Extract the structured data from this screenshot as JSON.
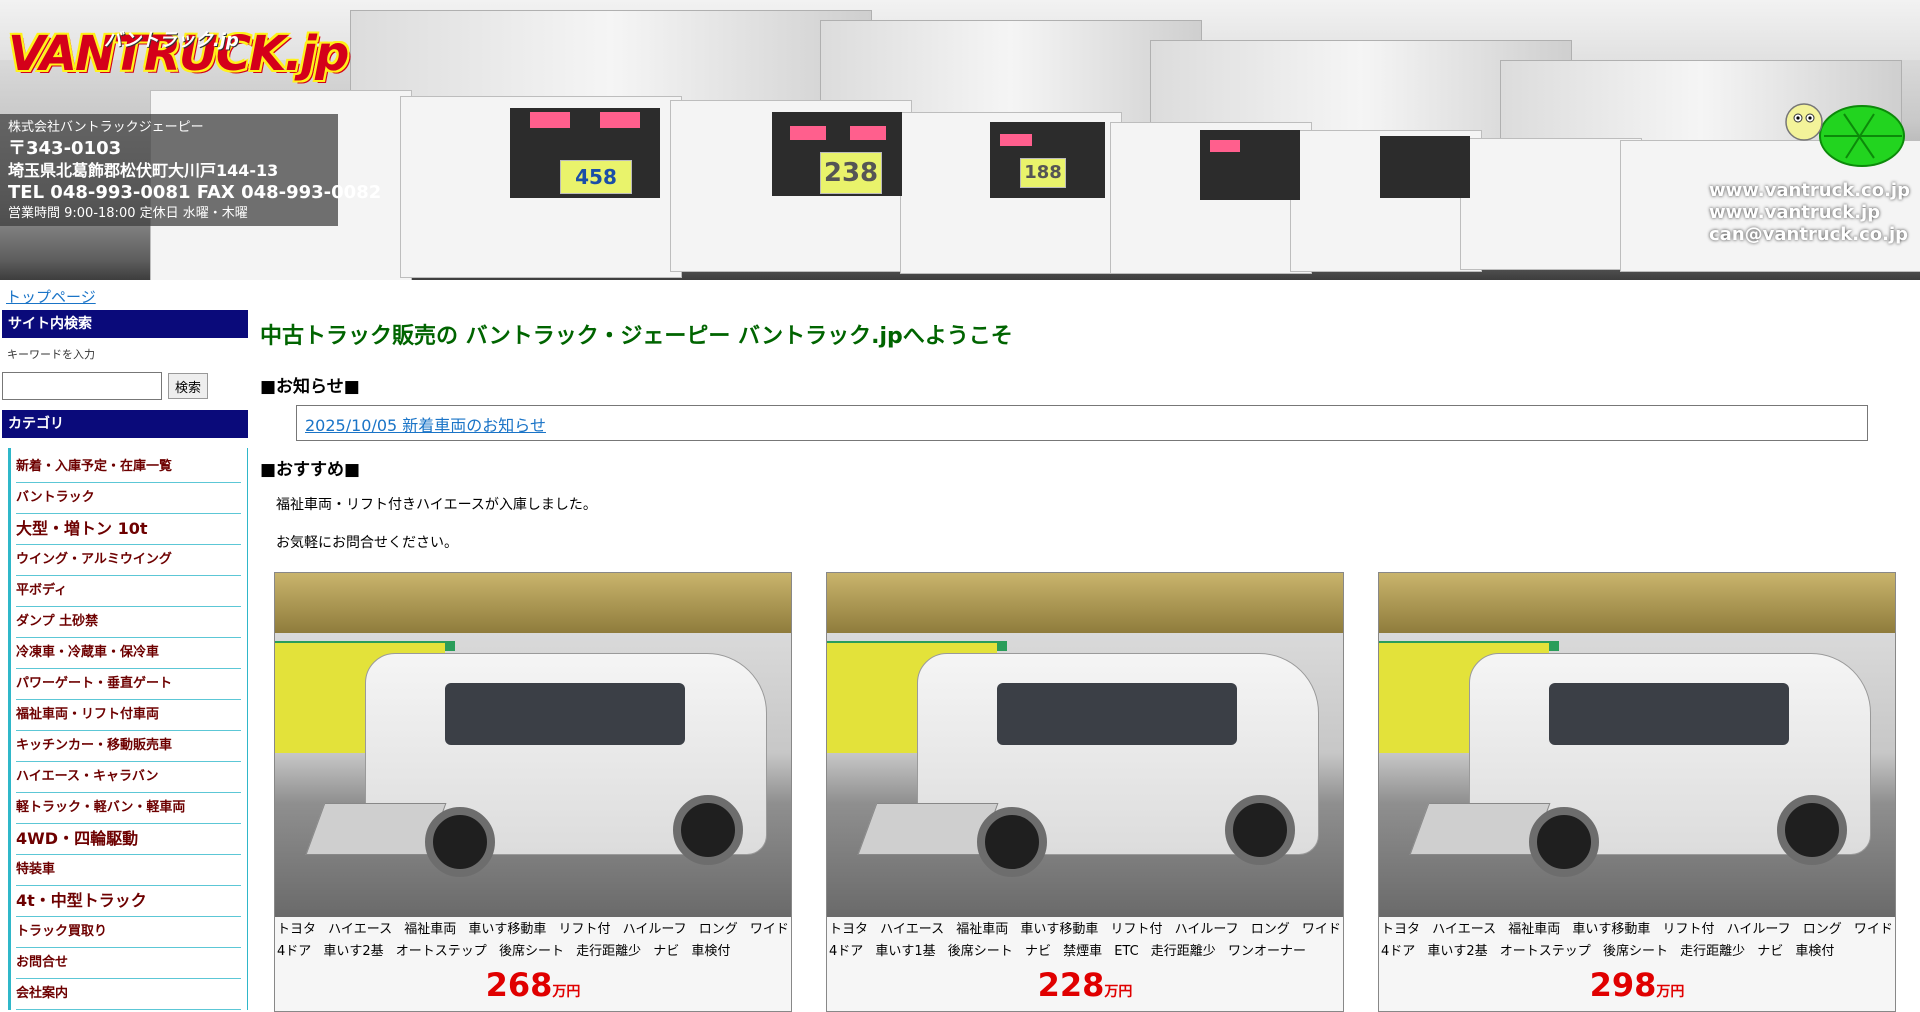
{
  "header": {
    "logo_main": "VANTRUCK.jp",
    "logo_kana": "バントラック.jp",
    "company": "株式会社バントラックジェーピー",
    "zip": "〒343-0103",
    "address": "埼玉県北葛飾郡松伏町大川戸144-13",
    "tel_fax": "TEL 048-993-0081 FAX 048-993-0082",
    "hours": "営業時間 9:00-18:00 定休日 水曜・木曜",
    "urls": [
      "www.vantruck.co.jp",
      "www.vantruck.jp",
      "can@vantruck.co.jp"
    ],
    "price_tags": [
      "458",
      "238",
      "188"
    ]
  },
  "breadcrumb": "トップページ",
  "sidebar": {
    "search_heading": "サイト内検索",
    "search_sub": "キーワードを入力",
    "search_value": "",
    "search_button": "検索",
    "category_heading": "カテゴリ",
    "categories": [
      {
        "label": "新着・入庫予定・在庫一覧",
        "large": false
      },
      {
        "label": "バントラック",
        "large": false
      },
      {
        "label": "大型・増トン 10t",
        "large": true
      },
      {
        "label": "ウイング・アルミウイング",
        "large": false
      },
      {
        "label": "平ボディ",
        "large": false
      },
      {
        "label": "ダンプ 土砂禁",
        "large": false
      },
      {
        "label": "冷凍車・冷蔵車・保冷車",
        "large": false
      },
      {
        "label": "パワーゲート・垂直ゲート",
        "large": false
      },
      {
        "label": "福祉車両・リフト付車両",
        "large": false
      },
      {
        "label": "キッチンカー・移動販売車",
        "large": false
      },
      {
        "label": "ハイエース・キャラバン",
        "large": false
      },
      {
        "label": "軽トラック・軽バン・軽車両",
        "large": false
      },
      {
        "label": "4WD・四輪駆動",
        "large": true
      },
      {
        "label": "特装車",
        "large": false
      },
      {
        "label": "4t・中型トラック",
        "large": true
      },
      {
        "label": "トラック買取り",
        "large": false
      },
      {
        "label": "お問合せ",
        "large": false
      },
      {
        "label": "会社案内",
        "large": false
      }
    ]
  },
  "main": {
    "title": "中古トラック販売の バントラック・ジェーピー バントラック.jpへようこそ",
    "news_heading": "■お知らせ■",
    "news_link": "2025/10/05 新着車両のお知らせ",
    "recommend_heading": "■おすすめ■",
    "intro_1": "福祉車両・リフト付きハイエースが入庫しました。",
    "intro_2": "お気軽にお問合せください。",
    "cards": [
      {
        "desc": "トヨタ ハイエース 福祉車両 車いす移動車 リフト付 ハイルーフ ロング ワイド 4ドア 車いす2基 オートステップ 後席シート 走行距離少 ナビ 車検付",
        "price": "268",
        "unit": "万円"
      },
      {
        "desc": "トヨタ ハイエース 福祉車両 車いす移動車 リフト付 ハイルーフ ロング ワイド 4ドア 車いす1基 後席シート ナビ 禁煙車 ETC 走行距離少 ワンオーナー",
        "price": "228",
        "unit": "万円"
      },
      {
        "desc": "トヨタ ハイエース 福祉車両 車いす移動車 リフト付 ハイルーフ ロング ワイド 4ドア 車いす2基 オートステップ 後席シート 走行距離少 ナビ 車検付",
        "price": "298",
        "unit": "万円"
      }
    ]
  }
}
